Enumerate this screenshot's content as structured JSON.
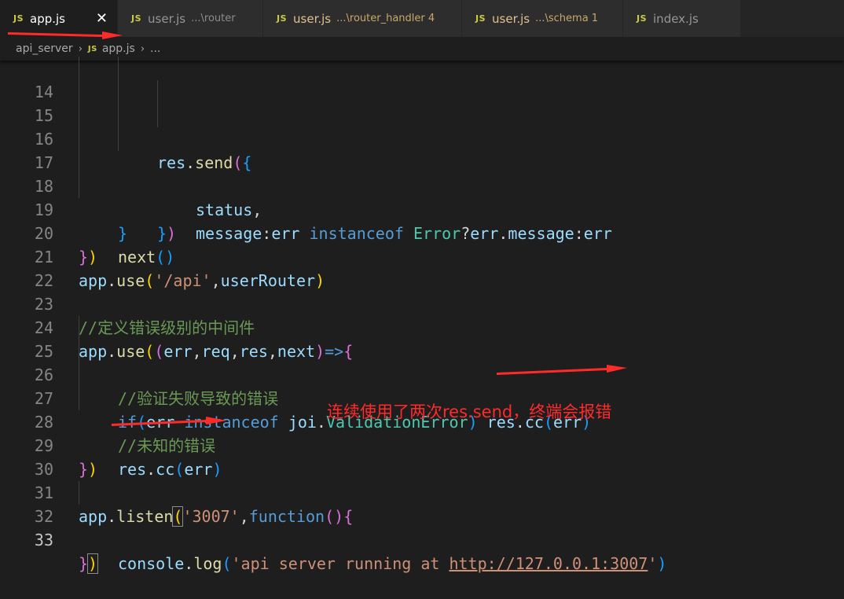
{
  "tabs": [
    {
      "icon": "JS",
      "name": "app.js",
      "desc": "",
      "active": true,
      "close": "✕"
    },
    {
      "icon": "JS",
      "name": "user.js",
      "desc": "...\\router"
    },
    {
      "icon": "JS",
      "name": "user.js",
      "desc": "...\\router_handler 4"
    },
    {
      "icon": "JS",
      "name": "user.js",
      "desc": "...\\schema 1"
    },
    {
      "icon": "JS",
      "name": "index.js",
      "desc": ""
    }
  ],
  "breadcrumb": {
    "folder": "api_server",
    "icon": "JS",
    "file": "app.js",
    "more": "..."
  },
  "line_numbers": [
    "14",
    "15",
    "16",
    "17",
    "18",
    "19",
    "20",
    "21",
    "22",
    "23",
    "24",
    "25",
    "26",
    "27",
    "28",
    "29",
    "30",
    "31",
    "32",
    "33"
  ],
  "code": {
    "l14": {
      "obj": "res",
      "dot": ".",
      "fn": "send",
      "open": "(",
      "brace": "{"
    },
    "l15": {
      "key": "status",
      "comma": ","
    },
    "l16": {
      "key": "message",
      "colon": ":",
      "v1": "err",
      "kw": "instanceof",
      "type": "Error",
      "q": "?",
      "v2": "err",
      "dot": ".",
      "prop": "message",
      "colon2": ":",
      "v3": "err"
    },
    "l17": {
      "close": "}",
      "paren": ")"
    },
    "l18": {
      "close": "}"
    },
    "l19": {
      "fn": "next",
      "parens": "()"
    },
    "l20": {
      "close": "}",
      "paren": ")"
    },
    "l21": {
      "obj": "app",
      "dot": ".",
      "fn": "use",
      "open": "(",
      "str": "'/api'",
      "comma": ",",
      "arg": "userRouter",
      "close": ")"
    },
    "l23": {
      "comment": "//定义错误级别的中间件"
    },
    "l24": {
      "obj": "app",
      "dot": ".",
      "fn": "use",
      "open": "(",
      "open2": "(",
      "p1": "err",
      "c1": ",",
      "p2": "req",
      "c2": ",",
      "p3": "res",
      "c3": ",",
      "p4": "next",
      "close2": ")",
      "arrow": "=>",
      "brace": "{"
    },
    "l25": {
      "comment": "//验证失败导致的错误"
    },
    "l26": {
      "kw": "if",
      "open": "(",
      "v1": "err",
      "kw2": "instanceof",
      "obj": "joi",
      "dot": ".",
      "type": "ValidationError",
      "close": ")",
      "obj2": "res",
      "dot2": ".",
      "fn": "cc",
      "open2": "(",
      "arg": "err",
      "close2": ")"
    },
    "l27": {
      "comment": "//未知的错误"
    },
    "l28": {
      "obj": "res",
      "dot": ".",
      "fn": "cc",
      "open": "(",
      "arg": "err",
      "close": ")"
    },
    "l29": {
      "close": "}",
      "paren": ")"
    },
    "l31": {
      "obj": "app",
      "dot": ".",
      "fn": "listen",
      "open": "(",
      "str": "'3007'",
      "comma": ",",
      "kw": "function",
      "parens": "()",
      "brace": "{"
    },
    "l32": {
      "obj": "console",
      "dot": ".",
      "fn": "log",
      "open": "(",
      "str1": "'api server running at ",
      "url": "http://127.0.0.1:3007",
      "str2": "'",
      "close": ")"
    },
    "l33": {
      "close": "}",
      "paren": ")"
    }
  },
  "annotation": {
    "text": "连续使用了两次res.send，终端会报错",
    "color": "#ff2a2a"
  },
  "colors": {
    "editor_bg": "#1e1e1e",
    "tab_bg": "#2d2d2d",
    "keyword": "#569cd6",
    "string": "#ce9178",
    "variable": "#9cdcfe",
    "function": "#dcdcaa",
    "type": "#4ec9b0",
    "comment": "#6a9955"
  }
}
